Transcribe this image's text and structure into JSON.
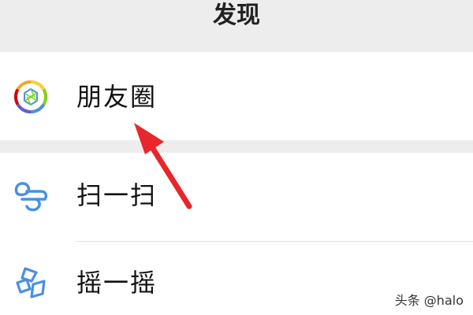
{
  "header": {
    "title": "发现"
  },
  "menu": {
    "items": [
      {
        "label": "朋友圈",
        "icon": "moments-icon"
      },
      {
        "label": "扫一扫",
        "icon": "scan-icon"
      },
      {
        "label": "摇一摇",
        "icon": "shake-icon"
      }
    ]
  },
  "watermark": {
    "text": "头条 @halo"
  },
  "colors": {
    "annotation_arrow": "#e8262b",
    "icon_blue": "#4a90e2",
    "header_background": "#ededed"
  }
}
